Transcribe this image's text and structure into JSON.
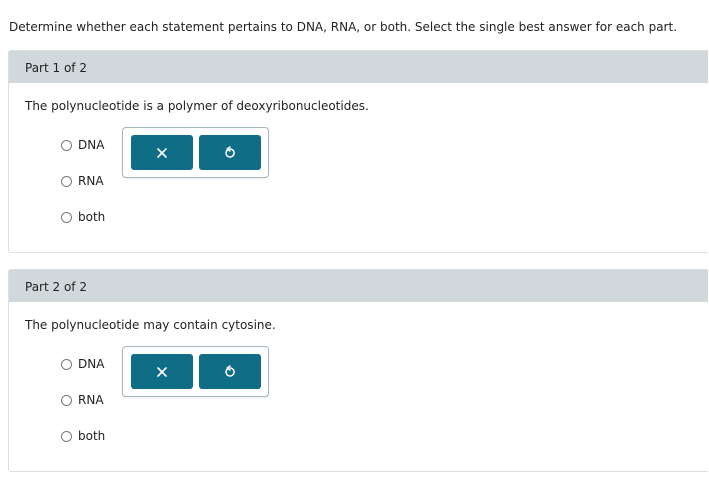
{
  "instructions": "Determine whether each statement pertains to DNA, RNA, or both. Select the single best answer for each part.",
  "parts": [
    {
      "header": "Part 1 of 2",
      "question": "The polynucleotide is a polymer of deoxyribonucleotides.",
      "options": [
        "DNA",
        "RNA",
        "both"
      ],
      "selected": null
    },
    {
      "header": "Part 2 of 2",
      "question": "The polynucleotide may contain cytosine.",
      "options": [
        "DNA",
        "RNA",
        "both"
      ],
      "selected": null
    }
  ],
  "toolbar": {
    "clear_icon": "x-icon",
    "undo_icon": "undo-icon"
  },
  "colors": {
    "header_bg": "#d0d8dc",
    "button_bg": "#0f6e86",
    "tool_border": "#a7b6bf"
  }
}
